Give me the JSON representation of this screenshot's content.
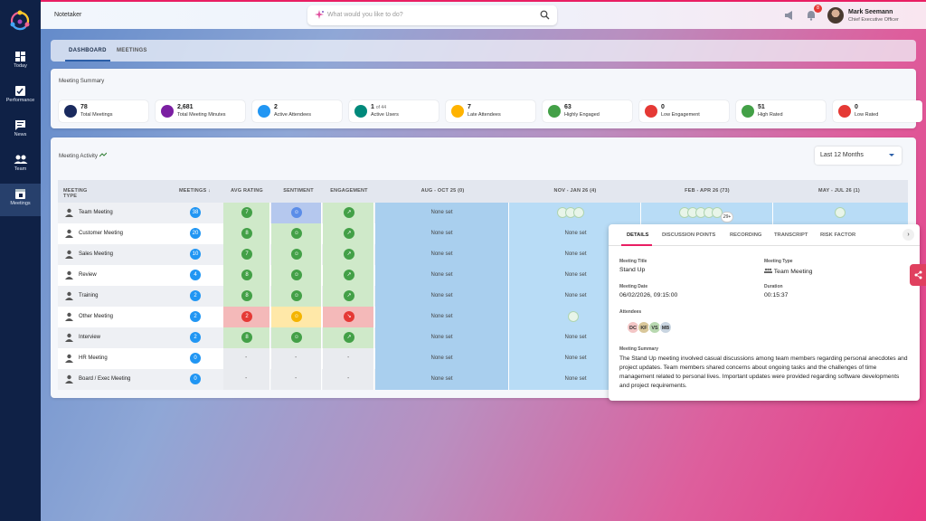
{
  "app": {
    "title": "Notetaker"
  },
  "sidebar": {
    "items": [
      {
        "label": "Today",
        "icon": "dashboard-icon"
      },
      {
        "label": "Performance",
        "icon": "performance-icon"
      },
      {
        "label": "News",
        "icon": "news-icon"
      },
      {
        "label": "Team",
        "icon": "team-icon"
      },
      {
        "label": "Meetings",
        "icon": "meetings-icon",
        "active": true
      }
    ]
  },
  "search": {
    "placeholder": "What would you like to do?"
  },
  "header": {
    "notification_count": "8",
    "user": {
      "name": "Mark Seemann",
      "role": "Chief Executive Officer"
    }
  },
  "tabs": [
    {
      "label": "DASHBOARD",
      "selected": true
    },
    {
      "label": "MEETINGS",
      "selected": false
    }
  ],
  "summary": {
    "title": "Meeting Summary",
    "stats": [
      {
        "value": "78",
        "extra": "",
        "label": "Total Meetings",
        "color": "#1a2a5e",
        "icon": "calendar-icon"
      },
      {
        "value": "2,681",
        "extra": "",
        "label": "Total Meeting Minutes",
        "color": "#7b1fa2",
        "icon": "clock-icon"
      },
      {
        "value": "2",
        "extra": "",
        "label": "Active Attendees",
        "color": "#2196f3",
        "icon": "people-icon"
      },
      {
        "value": "1",
        "extra": "of 44",
        "label": "Active Users",
        "color": "#00897b",
        "icon": "calendar-check-icon"
      },
      {
        "value": "7",
        "extra": "",
        "label": "Late Attendees",
        "color": "#ffb300",
        "icon": "alarm-icon"
      },
      {
        "value": "63",
        "extra": "",
        "label": "Highly Engaged",
        "color": "#43a047",
        "icon": "trend-up-icon"
      },
      {
        "value": "0",
        "extra": "",
        "label": "Low Engagement",
        "color": "#e53935",
        "icon": "trend-down-icon"
      },
      {
        "value": "51",
        "extra": "",
        "label": "High Rated",
        "color": "#43a047",
        "icon": "smile-icon"
      },
      {
        "value": "0",
        "extra": "",
        "label": "Low Rated",
        "color": "#e53935",
        "icon": "sad-icon"
      }
    ]
  },
  "activity": {
    "title": "Meeting Activity",
    "period_select": "Last 12 Months",
    "columns": [
      "MEETING TYPE",
      "MEETINGS",
      "AVG RATING",
      "SENTIMENT",
      "ENGAGEMENT",
      "AUG - OCT 25 (0)",
      "NOV - JAN 26 (4)",
      "FEB - APR 26 (73)",
      "MAY - JUL 26 (1)"
    ],
    "none_label": "None set",
    "more_label": "29+",
    "rows": [
      {
        "name": "Team Meeting",
        "icon": "team-meeting-icon",
        "count": "38",
        "rating": "7",
        "rating_tone": "green",
        "sentiment": "neutral",
        "engagement": "up",
        "aug": "None set",
        "nov": "avatars3",
        "feb": "avatars6"
      },
      {
        "name": "Customer Meeting",
        "icon": "customer-icon",
        "count": "20",
        "rating": "8",
        "rating_tone": "green",
        "sentiment": "positive",
        "engagement": "up",
        "aug": "None set",
        "nov": "None set"
      },
      {
        "name": "Sales Meeting",
        "icon": "sales-icon",
        "count": "10",
        "rating": "7",
        "rating_tone": "green",
        "sentiment": "positive",
        "engagement": "up",
        "aug": "None set",
        "nov": "None set"
      },
      {
        "name": "Review",
        "icon": "review-icon",
        "count": "4",
        "rating": "8",
        "rating_tone": "green",
        "sentiment": "positive",
        "engagement": "up",
        "aug": "None set",
        "nov": "None set"
      },
      {
        "name": "Training",
        "icon": "training-icon",
        "count": "2",
        "rating": "8",
        "rating_tone": "green",
        "sentiment": "positive",
        "engagement": "up",
        "aug": "None set",
        "nov": "None set"
      },
      {
        "name": "Other Meeting",
        "icon": "other-meeting-icon",
        "count": "2",
        "rating": "2",
        "rating_tone": "red",
        "sentiment": "neutral-yellow",
        "engagement": "down",
        "aug": "None set",
        "nov": "avatar1"
      },
      {
        "name": "Interview",
        "icon": "interview-icon",
        "count": "2",
        "rating": "8",
        "rating_tone": "green",
        "sentiment": "positive",
        "engagement": "up",
        "aug": "None set",
        "nov": "None set"
      },
      {
        "name": "HR Meeting",
        "icon": "hr-icon",
        "count": "0",
        "rating": "-",
        "rating_tone": "none",
        "sentiment": "-",
        "engagement": "-",
        "aug": "None set",
        "nov": "None set"
      },
      {
        "name": "Board / Exec Meeting",
        "icon": "board-icon",
        "count": "0",
        "rating": "-",
        "rating_tone": "none",
        "sentiment": "-",
        "engagement": "-",
        "aug": "None set",
        "nov": "None set"
      }
    ]
  },
  "details": {
    "tabs": [
      "DETAILS",
      "DISCUSSION POINTS",
      "RECORDING",
      "TRANSCRIPT",
      "RISK FACTOR"
    ],
    "meeting_title_label": "Meeting Title",
    "meeting_title": "Stand Up",
    "meeting_type_label": "Meeting Type",
    "meeting_type": "Team Meeting",
    "meeting_date_label": "Meeting Date",
    "meeting_date": "06/02/2026, 09:15:00",
    "duration_label": "Duration",
    "duration": "00:15:37",
    "attendees_label": "Attendees",
    "attendees": [
      "DC",
      "KF",
      "VS",
      "MB"
    ],
    "summary_label": "Meeting Summary",
    "summary": "The Stand Up meeting involved casual discussions among team members regarding personal anecdotes and project updates. Team members shared concerns about ongoing tasks and the challenges of time management related to personal lives. Important updates were provided regarding software developments and project requirements."
  }
}
